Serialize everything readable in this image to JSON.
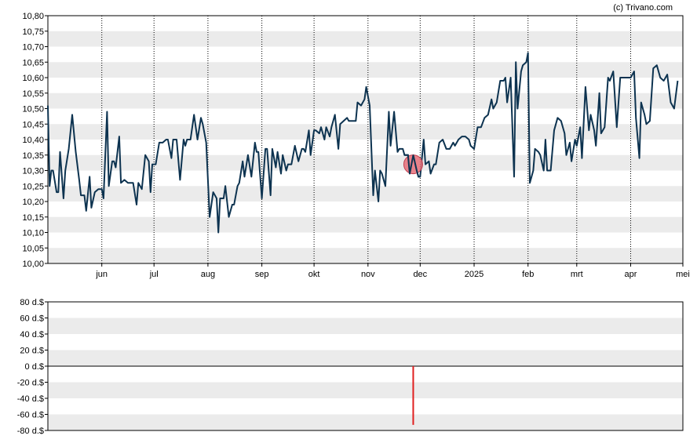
{
  "copyright": "(c) Trivano.com",
  "chart_data": [
    {
      "type": "line",
      "title": "",
      "xlabel": "",
      "ylabel": "",
      "ylim": [
        10.0,
        10.8
      ],
      "y_ticks": [
        "10,80",
        "10,75",
        "10,70",
        "10,65",
        "10,60",
        "10,55",
        "10,50",
        "10,45",
        "10,40",
        "10,35",
        "10,30",
        "10,25",
        "10,20",
        "10,15",
        "10,10",
        "10,05",
        "10,00"
      ],
      "x_range": [
        "2024-05-01",
        "2025-05-01"
      ],
      "x_ticks": [
        {
          "date": "2024-06-01",
          "label": "jun"
        },
        {
          "date": "2024-07-01",
          "label": "jul"
        },
        {
          "date": "2024-08-01",
          "label": "aug"
        },
        {
          "date": "2024-09-01",
          "label": "sep"
        },
        {
          "date": "2024-10-01",
          "label": "okt"
        },
        {
          "date": "2024-11-01",
          "label": "nov"
        },
        {
          "date": "2024-12-01",
          "label": "dec"
        },
        {
          "date": "2025-01-01",
          "label": "2025"
        },
        {
          "date": "2025-02-01",
          "label": "feb"
        },
        {
          "date": "2025-03-01",
          "label": "mrt"
        },
        {
          "date": "2025-04-01",
          "label": "apr"
        },
        {
          "date": "2025-05-01",
          "label": "mei"
        }
      ],
      "grid": "alternating horizontal bands, dotted vertical month lines",
      "line_color": "#0d3350",
      "marker": {
        "date": "2024-11-27",
        "value": 10.32,
        "color": "#e8707a"
      },
      "series": [
        {
          "values": [
            [
              "2024-05-01",
              10.51
            ],
            [
              "2024-05-02",
              10.25
            ],
            [
              "2024-05-03",
              10.3
            ],
            [
              "2024-05-04",
              10.3
            ],
            [
              "2024-05-06",
              10.23
            ],
            [
              "2024-05-07",
              10.23
            ],
            [
              "2024-05-08",
              10.36
            ],
            [
              "2024-05-10",
              10.21
            ],
            [
              "2024-05-11",
              10.3
            ],
            [
              "2024-05-13",
              10.37
            ],
            [
              "2024-05-15",
              10.48
            ],
            [
              "2024-05-17",
              10.36
            ],
            [
              "2024-05-19",
              10.27
            ],
            [
              "2024-05-20",
              10.22
            ],
            [
              "2024-05-22",
              10.22
            ],
            [
              "2024-05-23",
              10.17
            ],
            [
              "2024-05-25",
              10.28
            ],
            [
              "2024-05-26",
              10.18
            ],
            [
              "2024-05-28",
              10.23
            ],
            [
              "2024-05-30",
              10.24
            ],
            [
              "2024-06-01",
              10.24
            ],
            [
              "2024-06-02",
              10.21
            ],
            [
              "2024-06-04",
              10.49
            ],
            [
              "2024-06-05",
              10.25
            ],
            [
              "2024-06-07",
              10.33
            ],
            [
              "2024-06-08",
              10.33
            ],
            [
              "2024-06-09",
              10.31
            ],
            [
              "2024-06-11",
              10.41
            ],
            [
              "2024-06-12",
              10.26
            ],
            [
              "2024-06-14",
              10.27
            ],
            [
              "2024-06-16",
              10.26
            ],
            [
              "2024-06-18",
              10.26
            ],
            [
              "2024-06-19",
              10.26
            ],
            [
              "2024-06-21",
              10.19
            ],
            [
              "2024-06-22",
              10.26
            ],
            [
              "2024-06-24",
              10.24
            ],
            [
              "2024-06-26",
              10.35
            ],
            [
              "2024-06-28",
              10.33
            ],
            [
              "2024-06-29",
              10.23
            ],
            [
              "2024-06-30",
              10.32
            ],
            [
              "2024-07-02",
              10.32
            ],
            [
              "2024-07-04",
              10.39
            ],
            [
              "2024-07-05",
              10.39
            ],
            [
              "2024-07-06",
              10.39
            ],
            [
              "2024-07-08",
              10.4
            ],
            [
              "2024-07-09",
              10.4
            ],
            [
              "2024-07-11",
              10.34
            ],
            [
              "2024-07-12",
              10.4
            ],
            [
              "2024-07-14",
              10.4
            ],
            [
              "2024-07-16",
              10.27
            ],
            [
              "2024-07-18",
              10.4
            ],
            [
              "2024-07-19",
              10.38
            ],
            [
              "2024-07-20",
              10.4
            ],
            [
              "2024-07-22",
              10.4
            ],
            [
              "2024-07-24",
              10.48
            ],
            [
              "2024-07-25",
              10.44
            ],
            [
              "2024-07-26",
              10.4
            ],
            [
              "2024-07-28",
              10.47
            ],
            [
              "2024-07-29",
              10.45
            ],
            [
              "2024-07-31",
              10.39
            ],
            [
              "2024-08-02",
              10.15
            ],
            [
              "2024-08-04",
              10.23
            ],
            [
              "2024-08-06",
              10.21
            ],
            [
              "2024-08-07",
              10.1
            ],
            [
              "2024-08-08",
              10.21
            ],
            [
              "2024-08-10",
              10.21
            ],
            [
              "2024-08-11",
              10.25
            ],
            [
              "2024-08-13",
              10.15
            ],
            [
              "2024-08-15",
              10.19
            ],
            [
              "2024-08-16",
              10.19
            ],
            [
              "2024-08-18",
              10.25
            ],
            [
              "2024-08-19",
              10.26
            ],
            [
              "2024-08-21",
              10.33
            ],
            [
              "2024-08-22",
              10.28
            ],
            [
              "2024-08-24",
              10.35
            ],
            [
              "2024-08-26",
              10.28
            ],
            [
              "2024-08-28",
              10.39
            ],
            [
              "2024-08-29",
              10.36
            ],
            [
              "2024-08-30",
              10.36
            ],
            [
              "2024-09-01",
              10.21
            ],
            [
              "2024-09-03",
              10.37
            ],
            [
              "2024-09-04",
              10.37
            ],
            [
              "2024-09-06",
              10.22
            ],
            [
              "2024-09-07",
              10.37
            ],
            [
              "2024-09-09",
              10.31
            ],
            [
              "2024-09-10",
              10.36
            ],
            [
              "2024-09-12",
              10.29
            ],
            [
              "2024-09-13",
              10.35
            ],
            [
              "2024-09-15",
              10.3
            ],
            [
              "2024-09-16",
              10.32
            ],
            [
              "2024-09-18",
              10.32
            ],
            [
              "2024-09-20",
              10.38
            ],
            [
              "2024-09-22",
              10.33
            ],
            [
              "2024-09-24",
              10.37
            ],
            [
              "2024-09-25",
              10.37
            ],
            [
              "2024-09-26",
              10.36
            ],
            [
              "2024-09-28",
              10.43
            ],
            [
              "2024-09-29",
              10.35
            ],
            [
              "2024-10-01",
              10.43
            ],
            [
              "2024-10-02",
              10.43
            ],
            [
              "2024-10-04",
              10.42
            ],
            [
              "2024-10-05",
              10.44
            ],
            [
              "2024-10-07",
              10.4
            ],
            [
              "2024-10-08",
              10.44
            ],
            [
              "2024-10-10",
              10.41
            ],
            [
              "2024-10-11",
              10.44
            ],
            [
              "2024-10-13",
              10.48
            ],
            [
              "2024-10-15",
              10.37
            ],
            [
              "2024-10-16",
              10.45
            ],
            [
              "2024-10-18",
              10.46
            ],
            [
              "2024-10-20",
              10.47
            ],
            [
              "2024-10-21",
              10.46
            ],
            [
              "2024-10-23",
              10.46
            ],
            [
              "2024-10-25",
              10.46
            ],
            [
              "2024-10-26",
              10.52
            ],
            [
              "2024-10-28",
              10.51
            ],
            [
              "2024-10-30",
              10.53
            ],
            [
              "2024-10-31",
              10.57
            ],
            [
              "2024-11-02",
              10.51
            ],
            [
              "2024-11-04",
              10.22
            ],
            [
              "2024-11-05",
              10.3
            ],
            [
              "2024-11-07",
              10.2
            ],
            [
              "2024-11-08",
              10.3
            ],
            [
              "2024-11-09",
              10.29
            ],
            [
              "2024-11-11",
              10.25
            ],
            [
              "2024-11-13",
              10.49
            ],
            [
              "2024-11-14",
              10.38
            ],
            [
              "2024-11-16",
              10.49
            ],
            [
              "2024-11-18",
              10.36
            ],
            [
              "2024-11-19",
              10.37
            ],
            [
              "2024-11-21",
              10.37
            ],
            [
              "2024-11-22",
              10.35
            ],
            [
              "2024-11-24",
              10.35
            ],
            [
              "2024-11-25",
              10.29
            ],
            [
              "2024-11-27",
              10.35
            ],
            [
              "2024-11-29",
              10.3
            ],
            [
              "2024-11-30",
              10.28
            ],
            [
              "2024-12-01",
              10.28
            ],
            [
              "2024-12-03",
              10.4
            ],
            [
              "2024-12-04",
              10.32
            ],
            [
              "2024-12-06",
              10.33
            ],
            [
              "2024-12-07",
              10.29
            ],
            [
              "2024-12-09",
              10.32
            ],
            [
              "2024-12-10",
              10.32
            ],
            [
              "2024-12-12",
              10.39
            ],
            [
              "2024-12-14",
              10.4
            ],
            [
              "2024-12-16",
              10.37
            ],
            [
              "2024-12-18",
              10.37
            ],
            [
              "2024-12-20",
              10.39
            ],
            [
              "2024-12-21",
              10.38
            ],
            [
              "2024-12-23",
              10.4
            ],
            [
              "2024-12-25",
              10.41
            ],
            [
              "2024-12-27",
              10.41
            ],
            [
              "2024-12-29",
              10.4
            ],
            [
              "2024-12-30",
              10.38
            ],
            [
              "2025-01-01",
              10.37
            ],
            [
              "2025-01-03",
              10.44
            ],
            [
              "2025-01-05",
              10.44
            ],
            [
              "2025-01-07",
              10.47
            ],
            [
              "2025-01-09",
              10.48
            ],
            [
              "2025-01-11",
              10.53
            ],
            [
              "2025-01-12",
              10.5
            ],
            [
              "2025-01-14",
              10.52
            ],
            [
              "2025-01-16",
              10.59
            ],
            [
              "2025-01-18",
              10.59
            ],
            [
              "2025-01-19",
              10.6
            ],
            [
              "2025-01-20",
              10.52
            ],
            [
              "2025-01-22",
              10.6
            ],
            [
              "2025-01-24",
              10.28
            ],
            [
              "2025-01-25",
              10.65
            ],
            [
              "2025-01-26",
              10.5
            ],
            [
              "2025-01-28",
              10.62
            ],
            [
              "2025-01-29",
              10.64
            ],
            [
              "2025-01-31",
              10.65
            ],
            [
              "2025-02-01",
              10.68
            ],
            [
              "2025-02-02",
              10.26
            ],
            [
              "2025-02-04",
              10.3
            ],
            [
              "2025-02-05",
              10.37
            ],
            [
              "2025-02-07",
              10.36
            ],
            [
              "2025-02-08",
              10.35
            ],
            [
              "2025-02-10",
              10.3
            ],
            [
              "2025-02-11",
              10.4
            ],
            [
              "2025-02-12",
              10.3
            ],
            [
              "2025-02-14",
              10.3
            ],
            [
              "2025-02-16",
              10.43
            ],
            [
              "2025-02-18",
              10.47
            ],
            [
              "2025-02-20",
              10.46
            ],
            [
              "2025-02-22",
              10.42
            ],
            [
              "2025-02-23",
              10.35
            ],
            [
              "2025-02-25",
              10.39
            ],
            [
              "2025-02-26",
              10.33
            ],
            [
              "2025-02-28",
              10.4
            ],
            [
              "2025-03-01",
              10.38
            ],
            [
              "2025-03-03",
              10.44
            ],
            [
              "2025-03-04",
              10.34
            ],
            [
              "2025-03-06",
              10.57
            ],
            [
              "2025-03-08",
              10.43
            ],
            [
              "2025-03-09",
              10.48
            ],
            [
              "2025-03-11",
              10.43
            ],
            [
              "2025-03-12",
              10.38
            ],
            [
              "2025-03-14",
              10.55
            ],
            [
              "2025-03-15",
              10.42
            ],
            [
              "2025-03-17",
              10.44
            ],
            [
              "2025-03-19",
              10.6
            ],
            [
              "2025-03-20",
              10.59
            ],
            [
              "2025-03-22",
              10.62
            ],
            [
              "2025-03-24",
              10.44
            ],
            [
              "2025-03-26",
              10.6
            ],
            [
              "2025-03-28",
              10.6
            ],
            [
              "2025-03-29",
              10.6
            ],
            [
              "2025-04-01",
              10.6
            ],
            [
              "2025-04-03",
              10.62
            ],
            [
              "2025-04-04",
              10.47
            ],
            [
              "2025-04-06",
              10.34
            ],
            [
              "2025-04-07",
              10.52
            ],
            [
              "2025-04-09",
              10.48
            ],
            [
              "2025-04-10",
              10.45
            ],
            [
              "2025-04-12",
              10.46
            ],
            [
              "2025-04-14",
              10.63
            ],
            [
              "2025-04-16",
              10.64
            ],
            [
              "2025-04-18",
              10.6
            ],
            [
              "2025-04-20",
              10.59
            ],
            [
              "2025-04-22",
              10.61
            ],
            [
              "2025-04-24",
              10.52
            ],
            [
              "2025-04-26",
              10.5
            ],
            [
              "2025-04-28",
              10.59
            ]
          ]
        }
      ]
    },
    {
      "type": "bar",
      "title": "",
      "xlabel": "",
      "ylabel": "",
      "ylim": [
        -80,
        80
      ],
      "y_ticks": [
        "80 d.$",
        "60 d.$",
        "40 d.$",
        "20 d.$",
        "0 d.$",
        "-20 d.$",
        "-40 d.$",
        "-60 d.$",
        "-80 d.$"
      ],
      "x_range": [
        "2024-05-01",
        "2025-05-01"
      ],
      "grid": "alternating horizontal bands",
      "bar_color": "#e02020",
      "bars": [
        {
          "date": "2024-11-27",
          "value": -73
        }
      ]
    }
  ]
}
